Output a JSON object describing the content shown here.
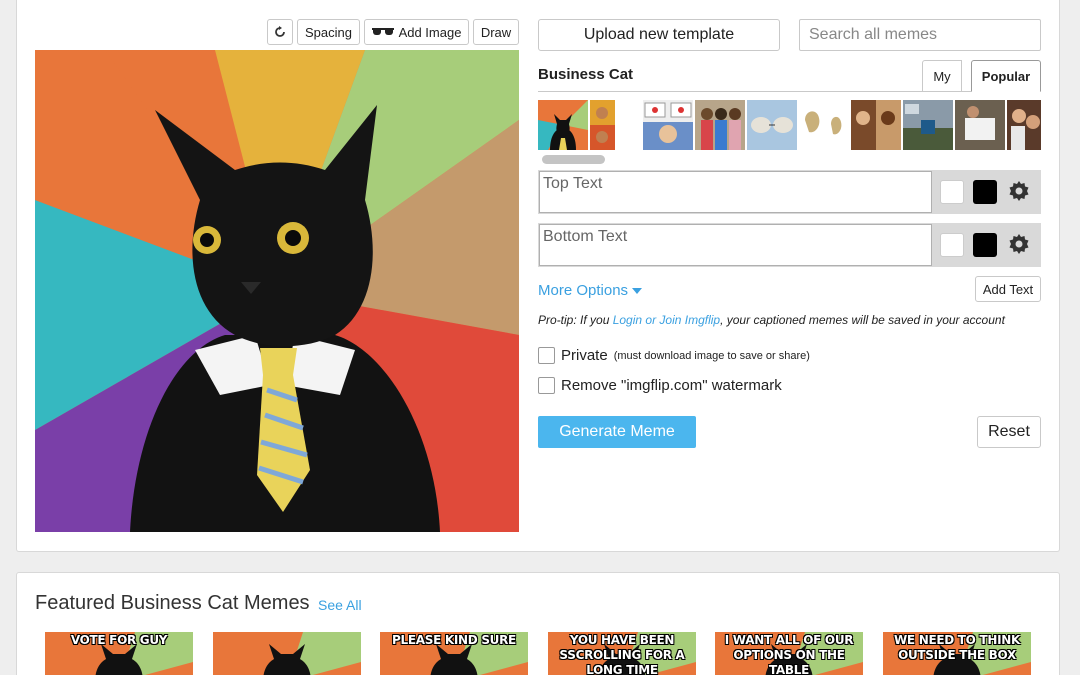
{
  "toolbar": {
    "rotate_icon": "rotate-icon",
    "spacing_label": "Spacing",
    "add_image_icon": "sunglasses-icon",
    "add_image_label": "Add Image",
    "draw_label": "Draw"
  },
  "header": {
    "upload_label": "Upload new template",
    "search_placeholder": "Search all memes"
  },
  "template": {
    "name": "Business Cat",
    "tabs": [
      {
        "label": "My",
        "active": false
      },
      {
        "label": "Popular",
        "active": true
      }
    ]
  },
  "text_boxes": [
    {
      "placeholder": "Top Text",
      "outline_color": "#ffffff",
      "fill_color": "#000000",
      "settings_icon": "gear-icon"
    },
    {
      "placeholder": "Bottom Text",
      "outline_color": "#ffffff",
      "fill_color": "#000000",
      "settings_icon": "gear-icon"
    }
  ],
  "options": {
    "more_options_label": "More Options",
    "add_text_label": "Add Text",
    "protip_prefix": "Pro-tip: If you ",
    "protip_link": "Login or Join Imgflip",
    "protip_suffix": ", your captioned memes will be saved in your account",
    "private_label": "Private",
    "private_note": "(must download image to save or share)",
    "watermark_label": "Remove \"imgflip.com\" watermark",
    "generate_label": "Generate Meme",
    "reset_label": "Reset"
  },
  "featured": {
    "title": "Featured Business Cat Memes",
    "see_all": "See All",
    "captions": [
      "VOTE FOR GUY",
      "",
      "PLEASE KIND SURE",
      "YOU HAVE BEEN\nSSCROLLING FOR A LONG TIME",
      "I WANT ALL OF OUR\nOPTIONS ON THE TABLE",
      "WE NEED TO THINK\nOUTSIDE THE BOX"
    ]
  },
  "colors": {
    "accent": "#4bb6ee",
    "link": "#3aa0e0",
    "text_row_bg": "#d9d9d9"
  }
}
